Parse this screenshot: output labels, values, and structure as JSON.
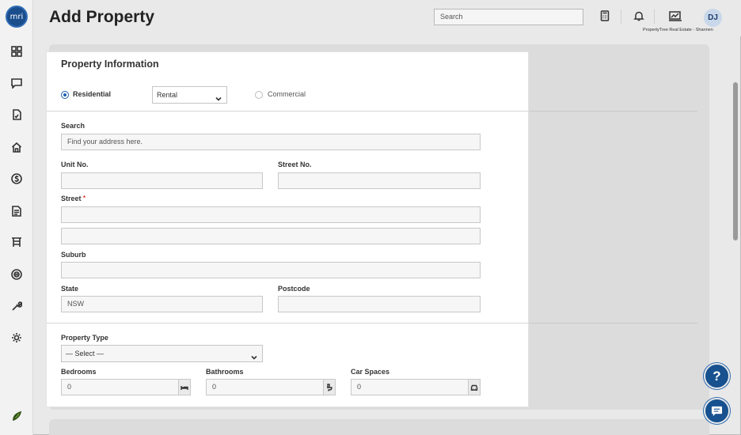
{
  "header": {
    "title": "Add Property",
    "search_placeholder": "Search",
    "avatar_initials": "DJ",
    "agency_text": "PropertyTree Real Estate - Shannen"
  },
  "sidebar": {
    "logo_text": "mri",
    "items": [
      "dashboard-icon",
      "messages-icon",
      "documents-icon",
      "properties-icon",
      "finance-icon",
      "reports-icon",
      "listings-icon",
      "integrations-icon",
      "maintenance-icon",
      "settings-icon",
      "brand-leaf-icon"
    ]
  },
  "form": {
    "title": "Property Information",
    "radio_residential": "Residential",
    "radio_commercial": "Commercial",
    "residential_type": "Rental",
    "search_label": "Search",
    "search_placeholder": "Find your address here.",
    "unit_label": "Unit No.",
    "street_no_label": "Street No.",
    "street_label": "Street",
    "street_required": "*",
    "suburb_label": "Suburb",
    "state_label": "State",
    "state_value": "NSW",
    "postcode_label": "Postcode",
    "property_type_label": "Property Type",
    "property_type_value": "— Select —",
    "bedrooms_label": "Bedrooms",
    "bedrooms_value": "0",
    "bathrooms_label": "Bathrooms",
    "bathrooms_value": "0",
    "car_spaces_label": "Car Spaces",
    "car_spaces_value": "0"
  },
  "fabs": {
    "help_label": "?"
  }
}
